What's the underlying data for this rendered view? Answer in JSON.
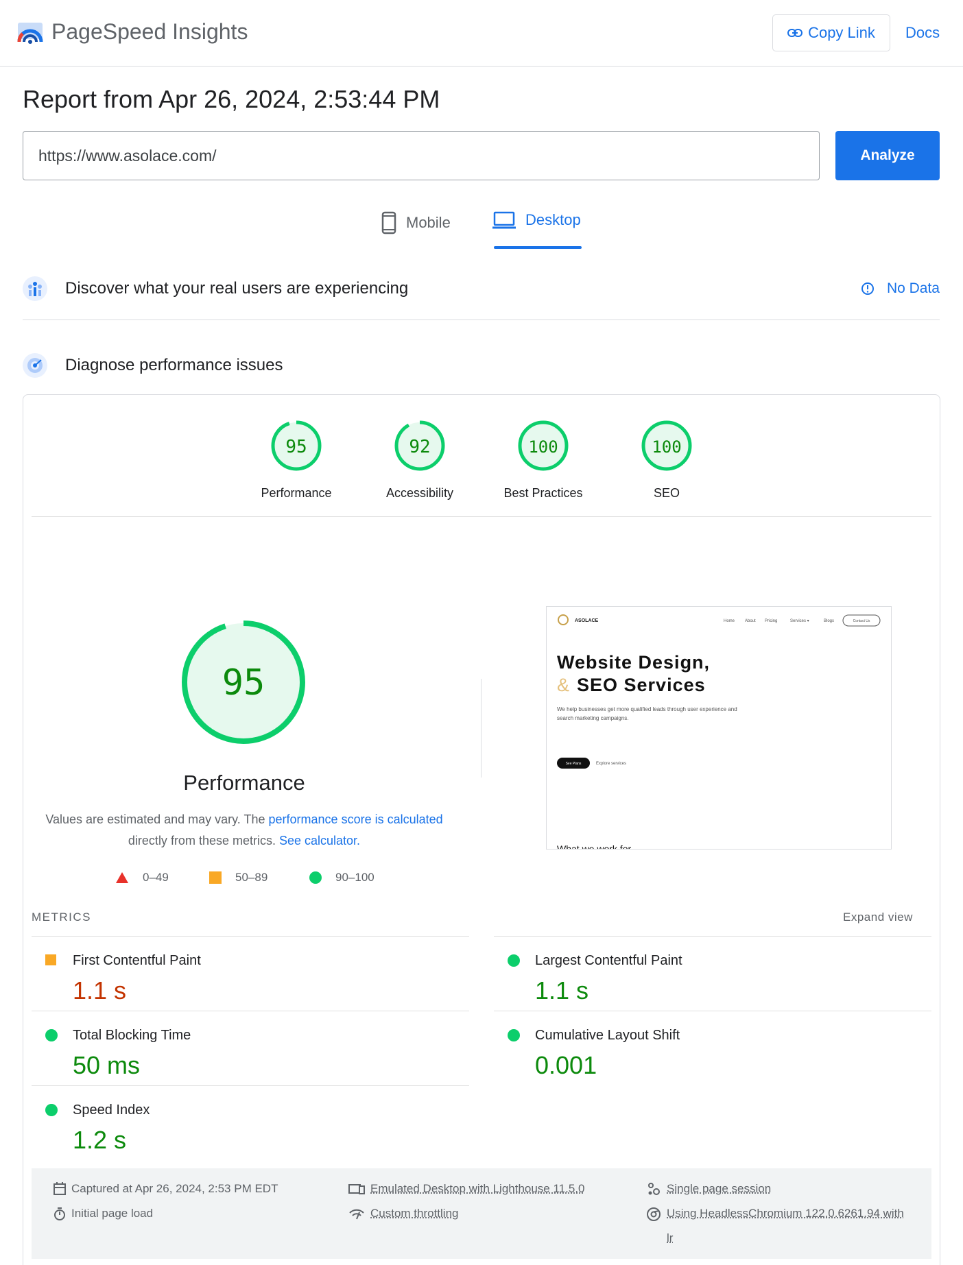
{
  "header": {
    "brand": "PageSpeed Insights",
    "copy_link": "Copy Link",
    "docs": "Docs"
  },
  "report": {
    "title": "Report from Apr 26, 2024, 2:53:44 PM",
    "url_value": "https://www.asolace.com/",
    "analyze": "Analyze"
  },
  "tabs": [
    {
      "label": "Mobile",
      "active": false
    },
    {
      "label": "Desktop",
      "active": true
    }
  ],
  "crux": {
    "title": "Discover what your real users are experiencing",
    "status": "No Data"
  },
  "diagnose": {
    "title": "Diagnose performance issues"
  },
  "scores": [
    {
      "label": "Performance",
      "value": 95
    },
    {
      "label": "Accessibility",
      "value": 92
    },
    {
      "label": "Best Practices",
      "value": 100
    },
    {
      "label": "SEO",
      "value": 100
    }
  ],
  "performance": {
    "score": 95,
    "title": "Performance",
    "desc_prefix": "Values are estimated and may vary. The ",
    "desc_link1": "performance score is calculated",
    "desc_mid": " directly from these metrics. ",
    "desc_link2": "See calculator."
  },
  "legend": [
    {
      "range": "0–49",
      "shape": "triangle",
      "color": "#e8312a"
    },
    {
      "range": "50–89",
      "shape": "square",
      "color": "#f9a825"
    },
    {
      "range": "90–100",
      "shape": "circle",
      "color": "#0cce6b"
    }
  ],
  "screenshot": {
    "brand": "ASOLACE",
    "nav": [
      "Home",
      "About",
      "Pricing",
      "Services ▾",
      "Blogs"
    ],
    "contact": "Contact Us",
    "headline1": "Website Design,",
    "amp": "&",
    "headline2": "SEO Services",
    "sub1": "We help businesses get more qualified leads through user experience and",
    "sub2": "search marketing campaigns.",
    "btn1": "See Plans",
    "btn2": "Explore services",
    "bottom": "What we work for"
  },
  "metrics_section": {
    "label": "METRICS",
    "expand": "Expand view"
  },
  "metrics": [
    {
      "name": "First Contentful Paint",
      "value": "1.1 s",
      "rating": "average"
    },
    {
      "name": "Largest Contentful Paint",
      "value": "1.1 s",
      "rating": "good"
    },
    {
      "name": "Total Blocking Time",
      "value": "50 ms",
      "rating": "good"
    },
    {
      "name": "Cumulative Layout Shift",
      "value": "0.001",
      "rating": "good"
    },
    {
      "name": "Speed Index",
      "value": "1.2 s",
      "rating": "good"
    }
  ],
  "footer": {
    "captured": "Captured at Apr 26, 2024, 2:53 PM EDT",
    "initial": "Initial page load",
    "emulated": "Emulated Desktop with Lighthouse 11.5.0",
    "throttling": "Custom throttling",
    "session": "Single page session",
    "browser_line1": "Using HeadlessChromium 122.0.6261.94 with",
    "browser_line2": "lr"
  },
  "colors": {
    "accent": "#1a73e8",
    "good": "#0cce6b",
    "good_text": "#0c8a0c",
    "average": "#f9a825",
    "average_text": "#c33300"
  }
}
